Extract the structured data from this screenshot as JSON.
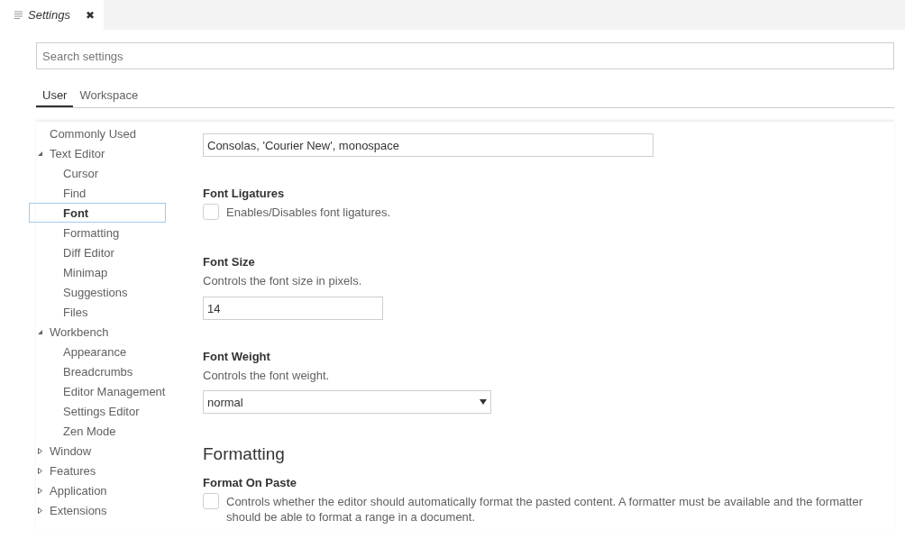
{
  "editor_tab": {
    "title": "Settings",
    "close": "✖"
  },
  "search": {
    "placeholder": "Search settings"
  },
  "scope_tabs": [
    {
      "label": "User",
      "selected": true
    },
    {
      "label": "Workspace",
      "selected": false
    }
  ],
  "toc": [
    {
      "label": "Commonly Used",
      "selected": false
    },
    {
      "label": "Text Editor",
      "expanded": true,
      "selected": false,
      "children": [
        {
          "label": "Cursor",
          "selected": false
        },
        {
          "label": "Find",
          "selected": false
        },
        {
          "label": "Font",
          "selected": true
        },
        {
          "label": "Formatting",
          "selected": false
        },
        {
          "label": "Diff Editor",
          "selected": false
        },
        {
          "label": "Minimap",
          "selected": false
        },
        {
          "label": "Suggestions",
          "selected": false
        },
        {
          "label": "Files",
          "selected": false
        }
      ]
    },
    {
      "label": "Workbench",
      "expanded": true,
      "selected": false,
      "children": [
        {
          "label": "Appearance",
          "selected": false
        },
        {
          "label": "Breadcrumbs",
          "selected": false
        },
        {
          "label": "Editor Management",
          "selected": false
        },
        {
          "label": "Settings Editor",
          "selected": false
        },
        {
          "label": "Zen Mode",
          "selected": false
        }
      ]
    },
    {
      "label": "Window",
      "expanded": false,
      "selected": false
    },
    {
      "label": "Features",
      "expanded": false,
      "selected": false
    },
    {
      "label": "Application",
      "expanded": false,
      "selected": false
    },
    {
      "label": "Extensions",
      "expanded": false,
      "selected": false
    }
  ],
  "settings": [
    {
      "kind": "text",
      "value": "Consolas, 'Courier New', monospace"
    },
    {
      "kind": "checkbox",
      "title": "Font Ligatures",
      "description": "Enables/Disables font ligatures.",
      "checked": false
    },
    {
      "kind": "number",
      "title": "Font Size",
      "description": "Controls the font size in pixels.",
      "value": "14"
    },
    {
      "kind": "select",
      "title": "Font Weight",
      "description": "Controls the font weight.",
      "value": "normal"
    },
    {
      "kind": "heading",
      "title": "Formatting"
    },
    {
      "kind": "checkbox",
      "title": "Format On Paste",
      "description": "Controls whether the editor should automatically format the pasted content. A formatter must be available and the formatter should be able to format a range in a document.",
      "checked": false
    }
  ]
}
